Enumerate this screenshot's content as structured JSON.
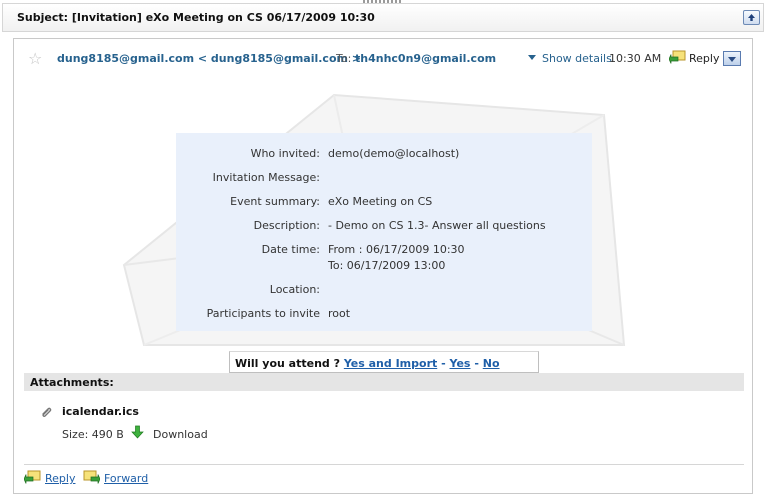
{
  "subject": "Subject: [Invitation] eXo Meeting on CS 06/17/2009 10:30",
  "header": {
    "from": "dung8185@gmail.com < dung8185@gmail.com >",
    "to_label": "To:",
    "to": "th4nhc0n9@gmail.com",
    "show_details": "Show details",
    "time": "10:30 AM",
    "reply": "Reply"
  },
  "invitation": {
    "rows": [
      {
        "label": "Who invited:",
        "value": "demo(demo@localhost)"
      },
      {
        "label": "Invitation Message:",
        "value": ""
      },
      {
        "label": "Event summary:",
        "value": "eXo Meeting on CS"
      },
      {
        "label": "Description:",
        "value": "- Demo on CS 1.3- Answer all questions"
      },
      {
        "label": "Date time:",
        "value": "From : 06/17/2009 10:30",
        "value2": "To: 06/17/2009 13:00"
      },
      {
        "label": "Location:",
        "value": ""
      },
      {
        "label": "Participants to invite",
        "value": "root"
      }
    ]
  },
  "attend": {
    "question": "Will you attend ?",
    "yes_import": "Yes and Import",
    "sep": "-",
    "yes": "Yes",
    "no": "No"
  },
  "attachments": {
    "title": "Attachments:",
    "file_name": "icalendar.ics",
    "size": "Size: 490 B",
    "download": "Download"
  },
  "footer": {
    "reply": "Reply",
    "forward": "Forward"
  },
  "icons": [
    "star-icon",
    "reply-icon",
    "chevron-down-icon",
    "arrow-up-icon",
    "paperclip-icon",
    "download-icon",
    "forward-icon"
  ]
}
